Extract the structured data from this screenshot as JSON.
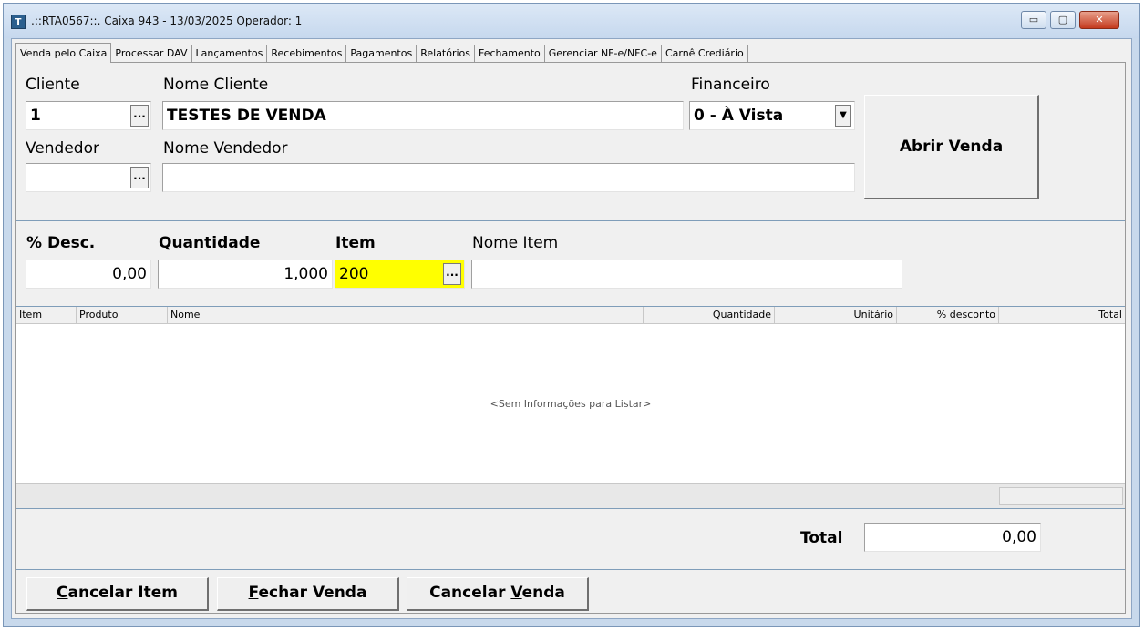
{
  "window": {
    "title": ".::RTA0567::. Caixa 943 - 13/03/2025 Operador: 1",
    "icon": "app-icon",
    "controls": {
      "minimize": "▭",
      "maximize": "▢",
      "close": "✕"
    }
  },
  "tabs": [
    {
      "label": "Venda pelo Caixa",
      "active": true
    },
    {
      "label": "Processar DAV"
    },
    {
      "label": "Lançamentos"
    },
    {
      "label": "Recebimentos"
    },
    {
      "label": "Pagamentos"
    },
    {
      "label": "Relatórios"
    },
    {
      "label": "Fechamento"
    },
    {
      "label": "Gerenciar NF-e/NFC-e"
    },
    {
      "label": "Carnê Crediário"
    }
  ],
  "header": {
    "cliente_label": "Cliente",
    "cliente_value": "1",
    "nome_cliente_label": "Nome Cliente",
    "nome_cliente_value": "TESTES DE VENDA",
    "financeiro_label": "Financeiro",
    "financeiro_value": "0 - À Vista",
    "vendedor_label": "Vendedor",
    "vendedor_value": "",
    "nome_vendedor_label": "Nome Vendedor",
    "nome_vendedor_value": "",
    "abrir_venda_label": "Abrir Venda",
    "ellipsis": "..."
  },
  "item_entry": {
    "desc_label": "% Desc.",
    "desc_value": "0,00",
    "quantidade_label": "Quantidade",
    "quantidade_value": "1,000",
    "item_label": "Item",
    "item_value": "200",
    "nome_item_label": "Nome Item",
    "nome_item_value": ""
  },
  "grid": {
    "columns": [
      "Item",
      "Produto",
      "Nome",
      "Quantidade",
      "Unitário",
      "% desconto",
      "Total"
    ],
    "empty_message": "<Sem Informações para Listar>"
  },
  "totals": {
    "total_label": "Total",
    "total_value": "0,00"
  },
  "actions": {
    "cancelar_item": {
      "first": "C",
      "rest": "ancelar Item"
    },
    "fechar_venda": {
      "first": "F",
      "rest": "echar Venda"
    },
    "cancelar_venda": {
      "pre": "Cancelar ",
      "first": "V",
      "rest": "enda"
    }
  },
  "colors": {
    "highlight_field": "#ffff00",
    "window_frame": "#c8d9ec",
    "close_button": "#c43a1e"
  }
}
